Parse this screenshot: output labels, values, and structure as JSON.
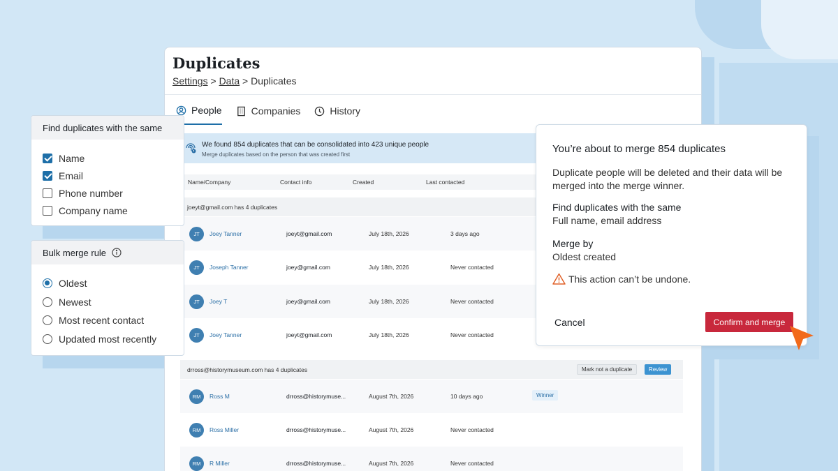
{
  "page": {
    "title": "Duplicates",
    "breadcrumb": {
      "settings": "Settings",
      "data": "Data",
      "sep": ">",
      "current": "Duplicates"
    }
  },
  "tabs": [
    {
      "label": "People",
      "icon": "person-icon",
      "active": true
    },
    {
      "label": "Companies",
      "icon": "building-icon",
      "active": false
    },
    {
      "label": "History",
      "icon": "clock-icon",
      "active": false
    }
  ],
  "banner": {
    "title": "We found 854 duplicates that can be consolidated into 423 unique people",
    "subtitle": "Merge duplicates based on the person that was created first"
  },
  "table": {
    "columns": [
      "Name/Company",
      "Contact info",
      "Created",
      "Last contacted"
    ],
    "groups": [
      {
        "header": "joeyt@gmail.com has 4 duplicates",
        "rows": [
          {
            "initials": "JT",
            "name": "Joey Tanner",
            "contact": "joeyt@gmail.com",
            "created": "July 18th, 2026",
            "last": "3 days ago"
          },
          {
            "initials": "JT",
            "name": "Joseph Tanner",
            "contact": "joey@gmail.com",
            "created": "July 18th, 2026",
            "last": "Never contacted"
          },
          {
            "initials": "JT",
            "name": "Joey T",
            "contact": "joey@gmail.com",
            "created": "July 18th, 2026",
            "last": "Never contacted"
          },
          {
            "initials": "JT",
            "name": "Joey Tanner",
            "contact": "joeyt@gmail.com",
            "created": "July 18th, 2026",
            "last": "Never contacted"
          }
        ]
      },
      {
        "header": "drross@historymuseum.com has 4 duplicates",
        "mark_label": "Mark not a duplicate",
        "review_label": "Review",
        "rows": [
          {
            "initials": "RM",
            "name": "Ross M",
            "contact": "drross@historymuse...",
            "created": "August 7th, 2026",
            "last": "10 days ago",
            "badge": "Winner"
          },
          {
            "initials": "RM",
            "name": "Ross Miller",
            "contact": "drross@historymuse...",
            "created": "August 7th, 2026",
            "last": "Never contacted"
          },
          {
            "initials": "RM",
            "name": "R Miller",
            "contact": "drross@historymuse...",
            "created": "August 7th, 2026",
            "last": "Never contacted"
          }
        ]
      }
    ]
  },
  "find_panel": {
    "title": "Find duplicates with the same",
    "options": [
      {
        "label": "Name",
        "checked": true
      },
      {
        "label": "Email",
        "checked": true
      },
      {
        "label": "Phone number",
        "checked": false
      },
      {
        "label": "Company name",
        "checked": false
      }
    ]
  },
  "merge_panel": {
    "title": "Bulk merge rule",
    "options": [
      {
        "label": "Oldest",
        "selected": true
      },
      {
        "label": "Newest",
        "selected": false
      },
      {
        "label": "Most recent contact",
        "selected": false
      },
      {
        "label": "Updated most recently",
        "selected": false
      }
    ]
  },
  "modal": {
    "title": "You’re about to merge 854 duplicates",
    "description": "Duplicate people will be deleted and their data will be merged into the merge winner.",
    "find_label": "Find duplicates with the same",
    "find_value": "Full name, email address",
    "merge_label": "Merge by",
    "merge_value": "Oldest created",
    "warning": "This action can’t be undone.",
    "cancel": "Cancel",
    "confirm": "Confirm and merge"
  },
  "colors": {
    "background": "#d2e7f6",
    "accent": "#1e6fa8",
    "link": "#2b6fa6",
    "danger": "#c8283c",
    "cursor": "#f26a1b",
    "warning": "#e0622a"
  }
}
